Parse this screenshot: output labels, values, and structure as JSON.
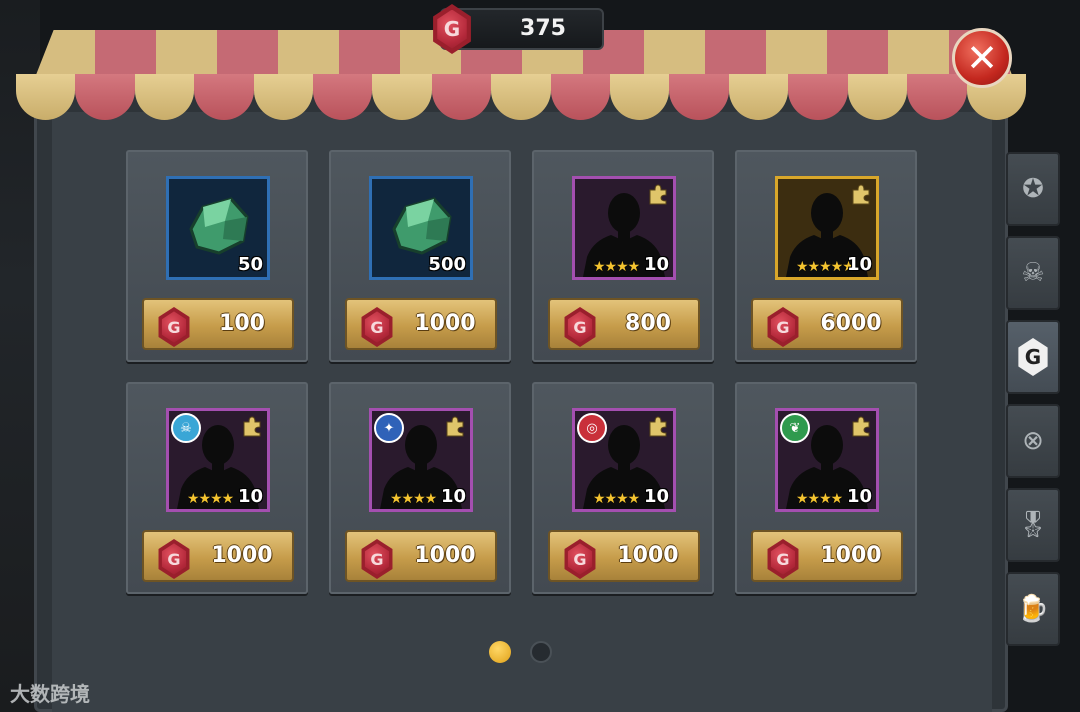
{
  "currency": {
    "icon": "g-gem-icon",
    "glyph": "G",
    "amount": "375"
  },
  "shop": {
    "items": [
      {
        "type": "ore",
        "quantity": "50",
        "price": "100",
        "frame": "blue"
      },
      {
        "type": "ore",
        "quantity": "500",
        "price": "1000",
        "frame": "blue"
      },
      {
        "type": "hero-fragment",
        "quantity": "10",
        "price": "800",
        "frame": "purple",
        "stars": 4
      },
      {
        "type": "hero-fragment",
        "quantity": "10",
        "price": "6000",
        "frame": "gold",
        "stars": 5
      },
      {
        "type": "hero-fragment",
        "quantity": "10",
        "price": "1000",
        "frame": "purple",
        "stars": 4,
        "faction": "skull-faction-icon"
      },
      {
        "type": "hero-fragment",
        "quantity": "10",
        "price": "1000",
        "frame": "purple",
        "stars": 4,
        "faction": "wings-faction-icon"
      },
      {
        "type": "hero-fragment",
        "quantity": "10",
        "price": "1000",
        "frame": "purple",
        "stars": 4,
        "faction": "target-faction-icon"
      },
      {
        "type": "hero-fragment",
        "quantity": "10",
        "price": "1000",
        "frame": "purple",
        "stars": 4,
        "faction": "leaf-faction-icon"
      }
    ]
  },
  "pagination": {
    "current": 1,
    "total": 2
  },
  "side_tabs": [
    {
      "icon": "emblem-icon",
      "active": false
    },
    {
      "icon": "skull-badge-icon",
      "active": false
    },
    {
      "icon": "g-currency-icon",
      "glyph": "G",
      "active": true
    },
    {
      "icon": "cross-circle-icon",
      "active": false
    },
    {
      "icon": "medal-icon",
      "active": false
    },
    {
      "icon": "beer-mug-icon",
      "active": false
    }
  ],
  "watermark": "大数跨境",
  "colors": {
    "gold_button": "#c69c4a",
    "gem_red": "#b3283a",
    "panel": "#394046"
  }
}
